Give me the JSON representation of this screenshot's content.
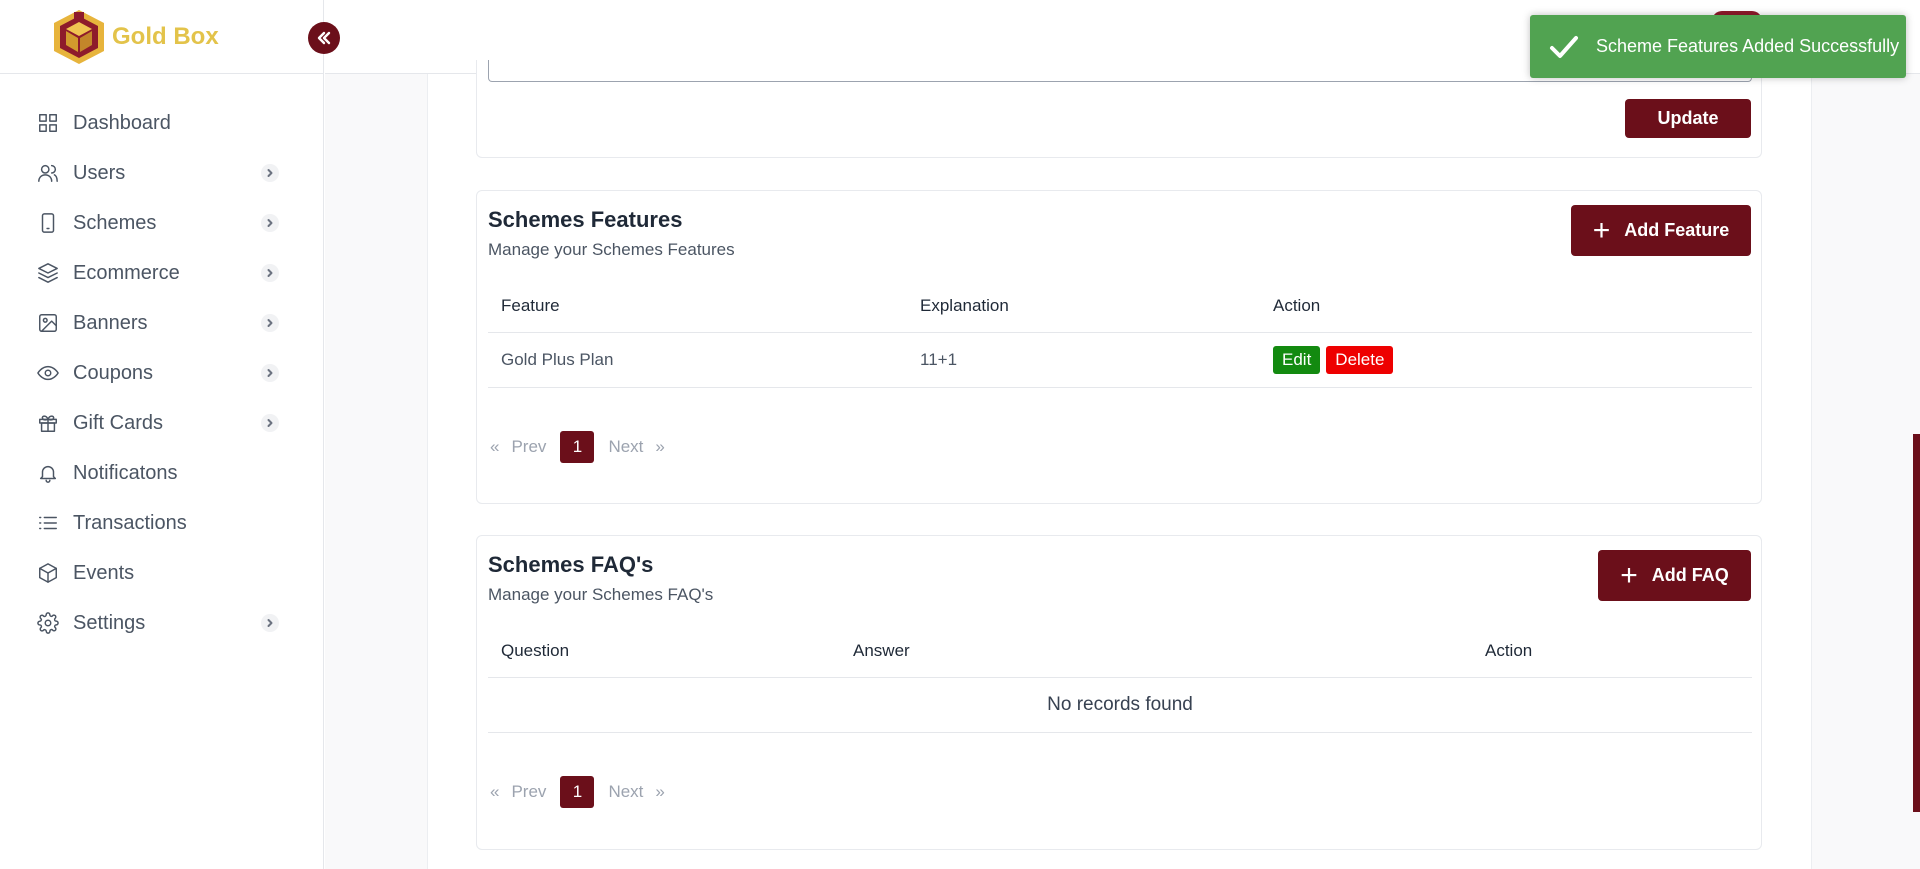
{
  "app": {
    "brand_name": "Gold Box"
  },
  "sidebar": {
    "items": [
      {
        "label": "Dashboard",
        "icon": "grid-icon",
        "has_chevron": false
      },
      {
        "label": "Users",
        "icon": "users-icon",
        "has_chevron": true
      },
      {
        "label": "Schemes",
        "icon": "tablet-icon",
        "has_chevron": true
      },
      {
        "label": "Ecommerce",
        "icon": "layers-icon",
        "has_chevron": true
      },
      {
        "label": "Banners",
        "icon": "image-icon",
        "has_chevron": true
      },
      {
        "label": "Coupons",
        "icon": "eye-icon",
        "has_chevron": true
      },
      {
        "label": "Gift Cards",
        "icon": "gift-icon",
        "has_chevron": true
      },
      {
        "label": "Notificatons",
        "icon": "bell-icon",
        "has_chevron": false
      },
      {
        "label": "Transactions",
        "icon": "list-icon",
        "has_chevron": false
      },
      {
        "label": "Events",
        "icon": "box-icon",
        "has_chevron": false
      },
      {
        "label": "Settings",
        "icon": "gear-icon",
        "has_chevron": true
      }
    ]
  },
  "top_card": {
    "update_label": "Update"
  },
  "features": {
    "title": "Schemes Features",
    "subtitle": "Manage your Schemes Features",
    "add_label": "Add Feature",
    "columns": [
      "Feature",
      "Explanation",
      "Action"
    ],
    "rows": [
      {
        "feature": "Gold Plus Plan",
        "explanation": "11+1",
        "edit": "Edit",
        "delete": "Delete"
      }
    ],
    "pager": {
      "first": "«",
      "prev": "Prev",
      "current": "1",
      "next": "Next",
      "last": "»"
    }
  },
  "faq": {
    "title": "Schemes FAQ's",
    "subtitle": "Manage your Schemes FAQ's",
    "add_label": "Add FAQ",
    "columns": [
      "Question",
      "Answer",
      "Action"
    ],
    "empty_text": "No records found",
    "pager": {
      "first": "«",
      "prev": "Prev",
      "current": "1",
      "next": "Next",
      "last": "»"
    }
  },
  "toast": {
    "message": "Scheme Features Added Successfully",
    "color": "#51a351"
  },
  "colors": {
    "primary": "#6b0f1a",
    "brand_gold": "#e3c34a",
    "edit": "#138a10",
    "delete": "#ee0000"
  }
}
